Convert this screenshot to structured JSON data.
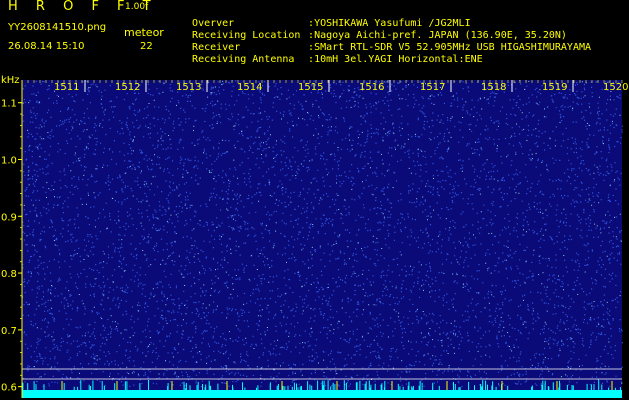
{
  "header": {
    "brand": "H R O F F T",
    "version": "1.00f",
    "filename": "YY2608141510.png",
    "timestamp": "26.08.14 15:10",
    "meteor_label": "meteor",
    "meteor_count": "22"
  },
  "info": [
    {
      "key": "Overver",
      "value": ":YOSHIKAWA Yasufumi /JG2MLI"
    },
    {
      "key": "Receiving Location",
      "value": ":Nagoya Aichi-pref. JAPAN (136.90E, 35.20N)"
    },
    {
      "key": "Receiver",
      "value": ":SMart RTL-SDR V5 52.905MHz USB HIGASHIMURAYAMA"
    },
    {
      "key": "Receiving Antenna",
      "value": ":10mH 3el.YAGI Horizontal:ENE"
    }
  ],
  "spectrogram": {
    "freq_unit": "kHz",
    "freq_ticks": [
      "1.1",
      "1.0",
      "0.9",
      "0.8",
      "0.7",
      "0.6"
    ],
    "time_labels": [
      "1511",
      "1512",
      "1513",
      "1514",
      "1515",
      "1516",
      "1517",
      "1518",
      "1519",
      "1520"
    ],
    "colors": {
      "background": "#000000",
      "text": "#ffff00",
      "waterfall_base": "#0a0a78",
      "noise_bright": "#3c6cff",
      "noise_speck": "#9fe8ff",
      "baseline": "#00ffff",
      "marker_line": "#ffffff"
    }
  }
}
